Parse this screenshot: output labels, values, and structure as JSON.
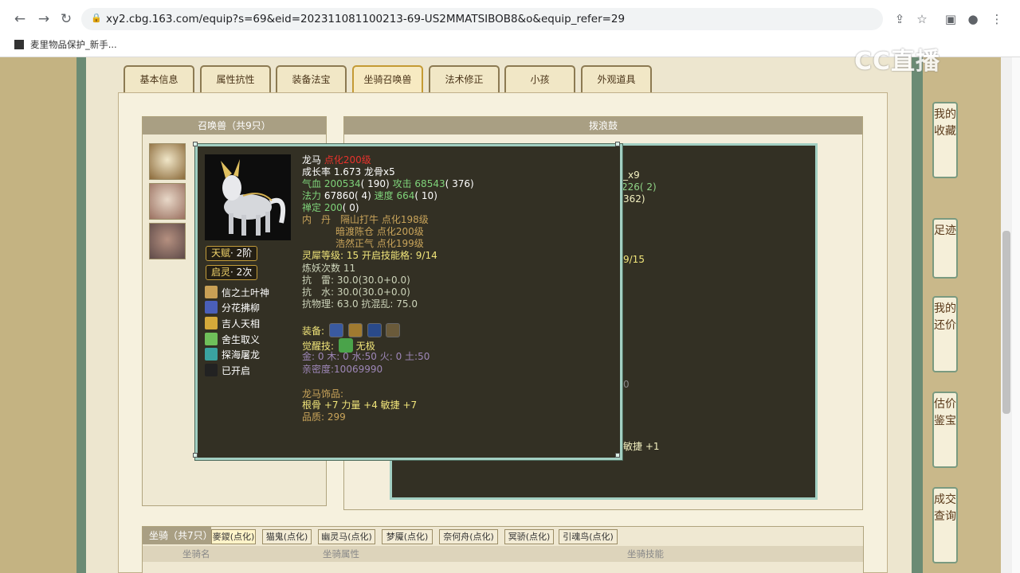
{
  "browser": {
    "url": "xy2.cbg.163.com/equip?s=69&eid=202311081100213-69-US2MMATSIBOB8&o&equip_refer=29",
    "bookmark": "麦里物品保护_新手..."
  },
  "watermark": "CC直播",
  "tabs": [
    "基本信息",
    "属性抗性",
    "装备法宝",
    "坐骑召唤兽",
    "法术修正",
    "小孩",
    "外观道具"
  ],
  "active_tab_index": 3,
  "right_sidebar": [
    "我的收藏",
    "足迹",
    "我的还价",
    "估价鉴宝",
    "成交查询"
  ],
  "pets_panel": {
    "title": "召唤兽（共9只）"
  },
  "right_panel": {
    "title": "拨浪鼓",
    "frag": [
      "_x9",
      "226( 2)",
      "362)",
      "9/15",
      "0",
      "敏捷 +1"
    ]
  },
  "tooltip": {
    "name": "龙马",
    "name_level": "点化200级",
    "growth_line": "成长率 1.673 龙骨x5",
    "hp_label": "气血",
    "hp_value": "200534",
    "hp_extra": "( 190)",
    "atk_label": "攻击",
    "atk_value": "68543",
    "atk_extra": "( 376)",
    "mp_label": "法力",
    "mp_value": "67860",
    "mp_extra": "( 4)",
    "spd_label": "速度",
    "spd_value": "664",
    "spd_extra": "( 10)",
    "zen_label": "禅定",
    "zen_value": "200",
    "zen_extra": "( 0)",
    "inner_label": "内　丹",
    "inner": [
      "隔山打牛 点化198级",
      "暗渡陈仓 点化200级",
      "浩然正气 点化199级"
    ],
    "lingxi": "灵犀等级: 15 开启技能格: 9/14",
    "lianyao": "炼妖次数 11",
    "resist_thunder_label": "抗　雷:",
    "resist_thunder_value": "30.0(30.0+0.0)",
    "resist_water_label": "抗　水:",
    "resist_water_value": "30.0(30.0+0.0)",
    "resist_phys": "抗物理: 63.0 抗混乱: 75.0",
    "equip_label": "装备:",
    "awaken_label": "觉醒技:",
    "awaken_skill": "无极",
    "elements": "金: 0 木: 0 水:50 火: 0 土:50",
    "intimacy": "亲密度:10069990",
    "ornament_title": "龙马饰品:",
    "ornament_stats": "根骨 +7 力量 +4 敏捷 +7",
    "ornament_quality": "品质:  299",
    "talent_badge": "天赋",
    "talent_value": "· 2阶",
    "spirit_badge": "启灵",
    "spirit_value": "· 2次",
    "skills": [
      {
        "name": "信之土叶神",
        "color": "#c9a055"
      },
      {
        "name": "分花拂柳",
        "color": "#4a5fb8"
      },
      {
        "name": "吉人天相",
        "color": "#d4a93a"
      },
      {
        "name": "舍生取义",
        "color": "#6fbf5a"
      },
      {
        "name": "探海屠龙",
        "color": "#3aa3a0"
      },
      {
        "name": "已开启",
        "color": "#222222"
      }
    ]
  },
  "mounts": {
    "title": "坐骑（共7只）",
    "tabs": [
      "麥鑁(点化)",
      "猫鬼(点化)",
      "幽灵马(点化)",
      "梦魇(点化)",
      "奈何舟(点化)",
      "冥骄(点化)",
      "引魂鸟(点化)"
    ],
    "columns": [
      "坐骑名",
      "坐骑属性",
      "坐骑技能"
    ]
  }
}
